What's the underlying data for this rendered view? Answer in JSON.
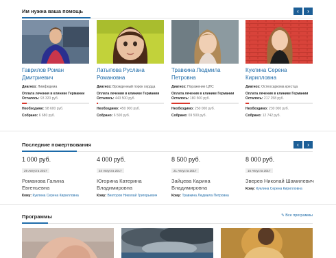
{
  "help": {
    "title": "Им нужна ваша помощь",
    "prev": "‹",
    "next": "›",
    "cards": [
      {
        "name": "Гаврилов Роман Дмитриевич",
        "diag_label": "Диагноз:",
        "diag_value": "Лимфедема",
        "clinic": "Оплата лечения в клинике Германии",
        "remain_label": "Осталось:",
        "remain_value": "93 320 руб.",
        "needed_label": "Необходимо:",
        "needed_value": "98 600 руб.",
        "collected_label": "Собрано:",
        "collected_value": "6 680 руб.",
        "progress": 0.068
      },
      {
        "name": "Латыпова Руслана Романовна",
        "diag_label": "Диагноз:",
        "diag_value": "Врожденный порок сердца",
        "clinic": "Оплата лечения в клинике Германии",
        "remain_label": "Осталось:",
        "remain_value": "443 500 руб.",
        "needed_label": "Необходимо:",
        "needed_value": "450 000 руб.",
        "collected_label": "Собрано:",
        "collected_value": "6 500 руб.",
        "progress": 0.014
      },
      {
        "name": "Травкина Людмила Петровна",
        "diag_label": "Диагноз:",
        "diag_value": "Поражение ЦНС",
        "clinic": "Оплата лечения в клинике Германии",
        "remain_label": "Осталось:",
        "remain_value": "180 500 руб.",
        "needed_label": "Необходимо:",
        "needed_value": "250 000 руб.",
        "collected_label": "Собрано:",
        "collected_value": "69 500 руб.",
        "progress": 0.278
      },
      {
        "name": "Куклина Серена Кирилловна",
        "diag_label": "Диагноз:",
        "diag_value": "Остеосаркома крестца",
        "clinic": "Оплата лечения в клинике Германии",
        "remain_label": "Осталось:",
        "remain_value": "217 258 руб.",
        "needed_label": "Необходимо:",
        "needed_value": "230 000 руб.",
        "collected_label": "Собрано:",
        "collected_value": "12 742 руб.",
        "progress": 0.055
      }
    ]
  },
  "donations": {
    "title": "Последние пожертвования",
    "prev": "‹",
    "next": "›",
    "to_label": "Кому:",
    "items": [
      {
        "amount": "1 000 руб.",
        "date": "29 Августа 2017",
        "person": "Романова Галина Евгеньевна",
        "to": "Куклина Серена Кирилловна"
      },
      {
        "amount": "4 000 руб.",
        "date": "24 Августа 2017",
        "person": "Югорина Катерина Владимировна",
        "to": "Викторов Николай Григорьевич"
      },
      {
        "amount": "8 500 руб.",
        "date": "21 Августа 2017",
        "person": "Зайцева Карина Владимировна",
        "to": "Травкина Людмила Петровна"
      },
      {
        "amount": "8 000 руб.",
        "date": "15 Августа 2017",
        "person": "Зверев Николай Шамилевич",
        "to": "Куклина Серена Кирилловна"
      }
    ]
  },
  "programs": {
    "title": "Программы",
    "all_link": "✎ Все программы"
  },
  "colors": {
    "accent": "#1c6aa8",
    "nav_button": "#1c5e96",
    "progress": "#d9362b"
  }
}
